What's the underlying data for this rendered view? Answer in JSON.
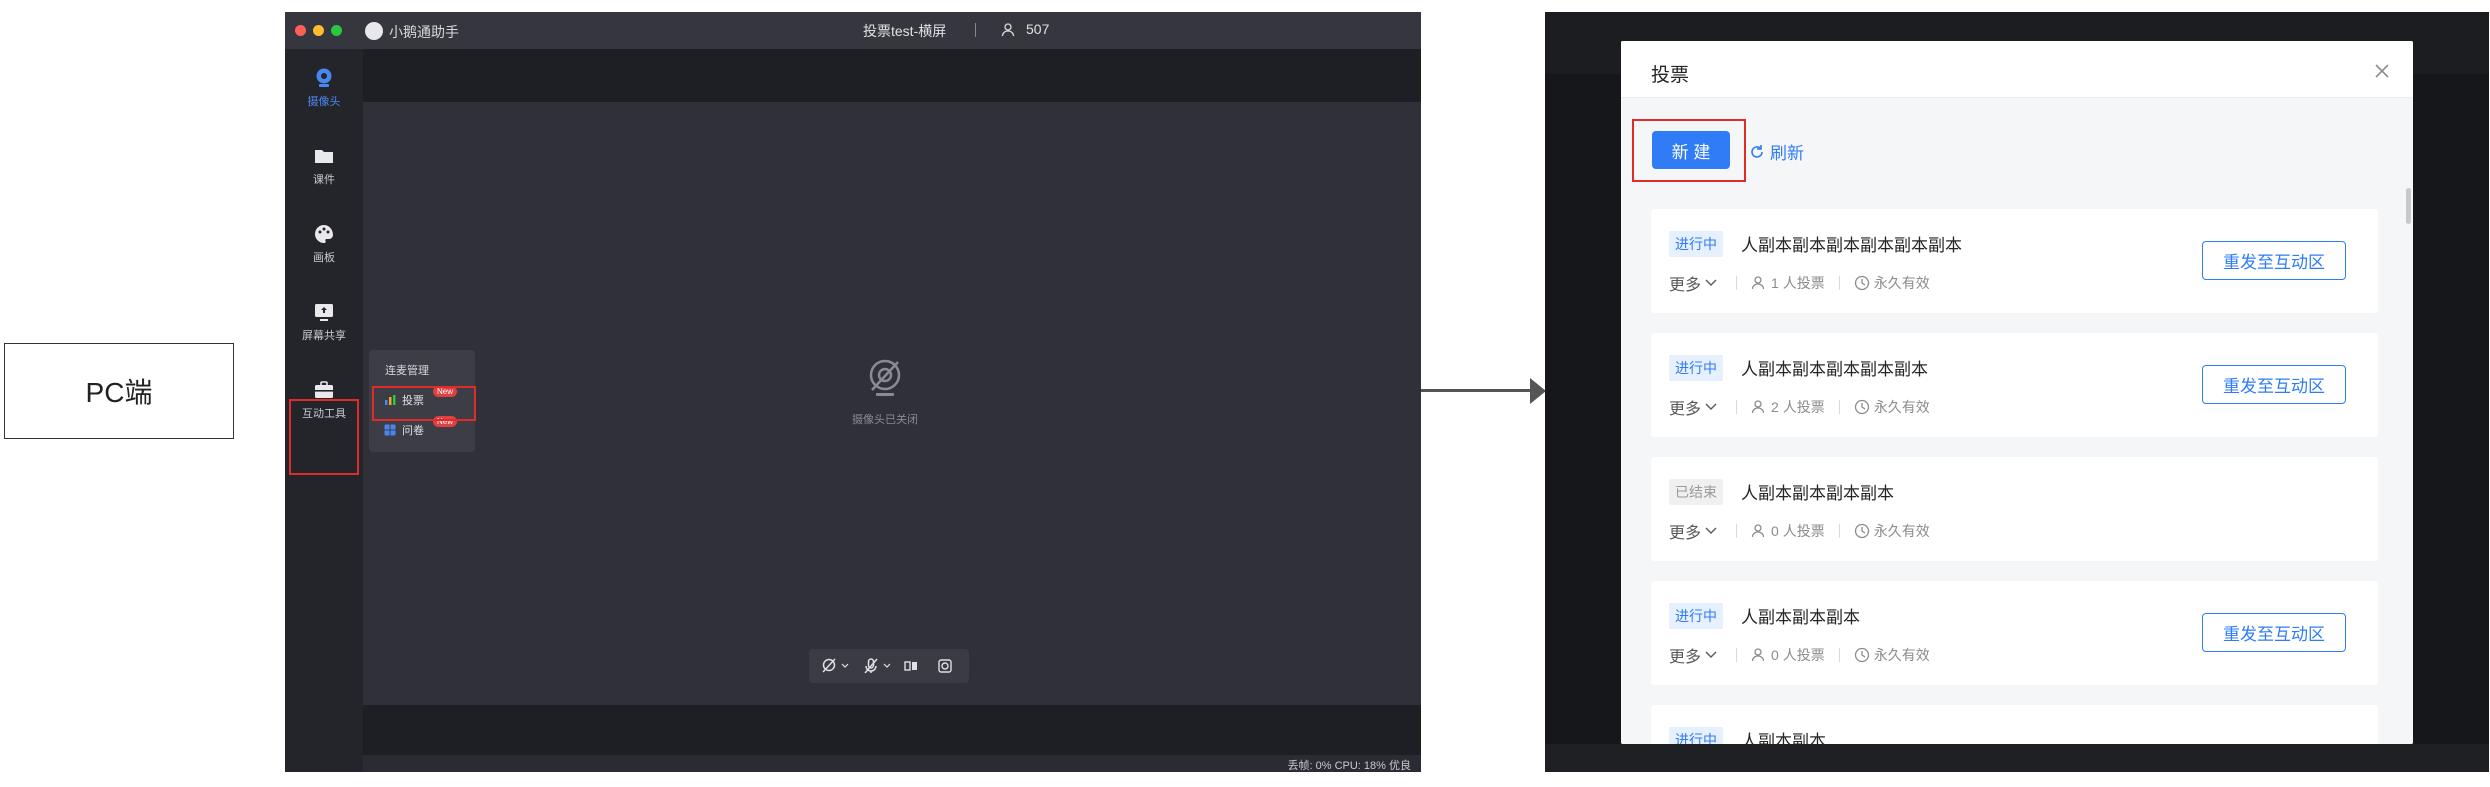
{
  "pc_label": "PC端",
  "app": {
    "name": "小鹅通助手",
    "meeting_title": "投票test-横屏",
    "people_count": "507",
    "colors": {
      "close": "#ff5f57",
      "minimize": "#febc2e",
      "maximize": "#28c840",
      "accent": "#4a86f0",
      "highlight": "#e02b2b"
    },
    "sidebar": [
      {
        "id": "camera",
        "label": "摄像头",
        "icon": "camera-icon",
        "active": true
      },
      {
        "id": "courseware",
        "label": "课件",
        "icon": "folder-icon",
        "active": false
      },
      {
        "id": "palette",
        "label": "画板",
        "icon": "palette-icon",
        "active": false
      },
      {
        "id": "screenshare",
        "label": "屏幕共享",
        "icon": "screen-share-icon",
        "active": false
      },
      {
        "id": "interactive",
        "label": "互动工具",
        "icon": "toolbox-icon",
        "active": false
      }
    ],
    "camera_off_text": "摄像头已关闭",
    "status_bar": "丢帧:  0%  CPU: 18%  优良",
    "tool_menu": {
      "title": "连麦管理",
      "items": [
        {
          "label": "投票",
          "badge": "New",
          "icon": "bar-chart-icon"
        },
        {
          "label": "问卷",
          "badge": "New",
          "icon": "grid-icon"
        }
      ]
    }
  },
  "dialog": {
    "title": "投票",
    "new_button": "新 建",
    "refresh": "刷新",
    "more_label": "更多",
    "validity": "永久有效",
    "resend_label": "重发至互动区",
    "votes": [
      {
        "status": "进行中",
        "status_type": "active",
        "name": "人副本副本副本副本副本副本",
        "voters": "1 人投票",
        "resend": true
      },
      {
        "status": "进行中",
        "status_type": "active",
        "name": "人副本副本副本副本副本",
        "voters": "2 人投票",
        "resend": true
      },
      {
        "status": "已结束",
        "status_type": "ended",
        "name": "人副本副本副本副本",
        "voters": "0 人投票",
        "resend": false
      },
      {
        "status": "进行中",
        "status_type": "active",
        "name": "人副本副本副本",
        "voters": "0 人投票",
        "resend": true
      },
      {
        "status": "进行中",
        "status_type": "active",
        "name": "人副本副本",
        "voters": "",
        "resend": false
      }
    ]
  }
}
